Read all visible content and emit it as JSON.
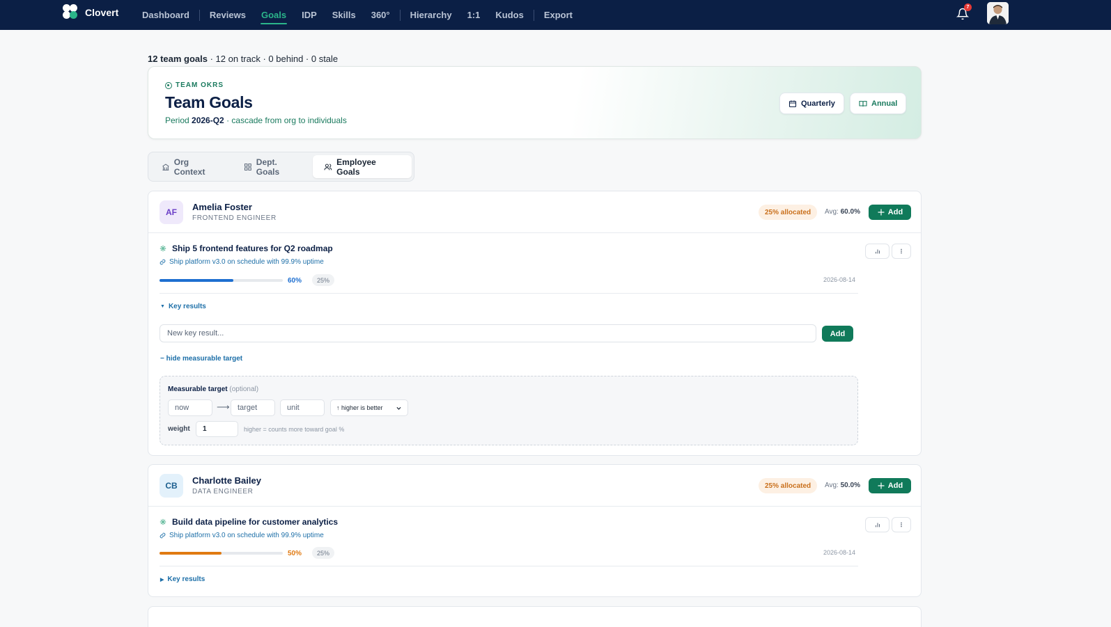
{
  "nav": {
    "brand": "Clovert",
    "items": [
      "Dashboard",
      "Reviews",
      "Goals",
      "IDP",
      "Skills",
      "360°",
      "Hierarchy",
      "1:1",
      "Kudos",
      "Export"
    ],
    "active": "Goals",
    "notification_count": "7"
  },
  "summary": {
    "count": "12 team goals",
    "rest": " · 12 on track · 0 behind · 0 stale"
  },
  "header": {
    "eyebrow": "TEAM OKRS",
    "title": "Team Goals",
    "period_prefix": "Period ",
    "period": "2026-Q2",
    "period_suffix": " · cascade from org to individuals",
    "quarterly_label": "Quarterly",
    "annual_label": "Annual"
  },
  "tabs": [
    {
      "label": "Org Context",
      "icon": "building-icon"
    },
    {
      "label": "Dept. Goals",
      "icon": "grid-icon"
    },
    {
      "label": "Employee Goals",
      "icon": "users-icon"
    }
  ],
  "employees": [
    {
      "initials": "AF",
      "name": "Amelia Foster",
      "role": "FRONTEND ENGINEER",
      "allocated": "25% allocated",
      "avg_label": "Avg: ",
      "avg_value": "60.0%",
      "add_label": "Add",
      "goal": {
        "title": "Ship 5 frontend features for Q2 roadmap",
        "parent": "Ship platform v3.0 on schedule with 99.9% uptime",
        "progress": 0.6,
        "progress_label": "60%",
        "weight": "25%",
        "date": "2026-08-14",
        "key_results_label": "Key results",
        "kr_placeholder": "New key result...",
        "kr_add_label": "Add",
        "hide_target_label": "− hide measurable target",
        "target": {
          "title": "Measurable target",
          "optional": " (optional)",
          "now_placeholder": "now",
          "target_placeholder": "target",
          "unit_placeholder": "unit",
          "direction": "↑ higher is better",
          "weight_label": "weight",
          "weight_value": "1",
          "weight_hint": "higher = counts more toward goal %"
        }
      }
    },
    {
      "initials": "CB",
      "name": "Charlotte Bailey",
      "role": "DATA ENGINEER",
      "allocated": "25% allocated",
      "avg_label": "Avg: ",
      "avg_value": "50.0%",
      "add_label": "Add",
      "goal": {
        "title": "Build data pipeline for customer analytics",
        "parent": "Ship platform v3.0 on schedule with 99.9% uptime",
        "progress": 0.5,
        "progress_label": "50%",
        "weight": "25%",
        "date": "2026-08-14",
        "key_results_label": "Key results"
      }
    }
  ],
  "colors": {
    "nav_bg": "#0b1f45",
    "accent_green": "#107a5a",
    "progress_blue": "#1e6fd0",
    "progress_orange": "#e07a12",
    "alloc_bg": "#fdf0e3"
  }
}
